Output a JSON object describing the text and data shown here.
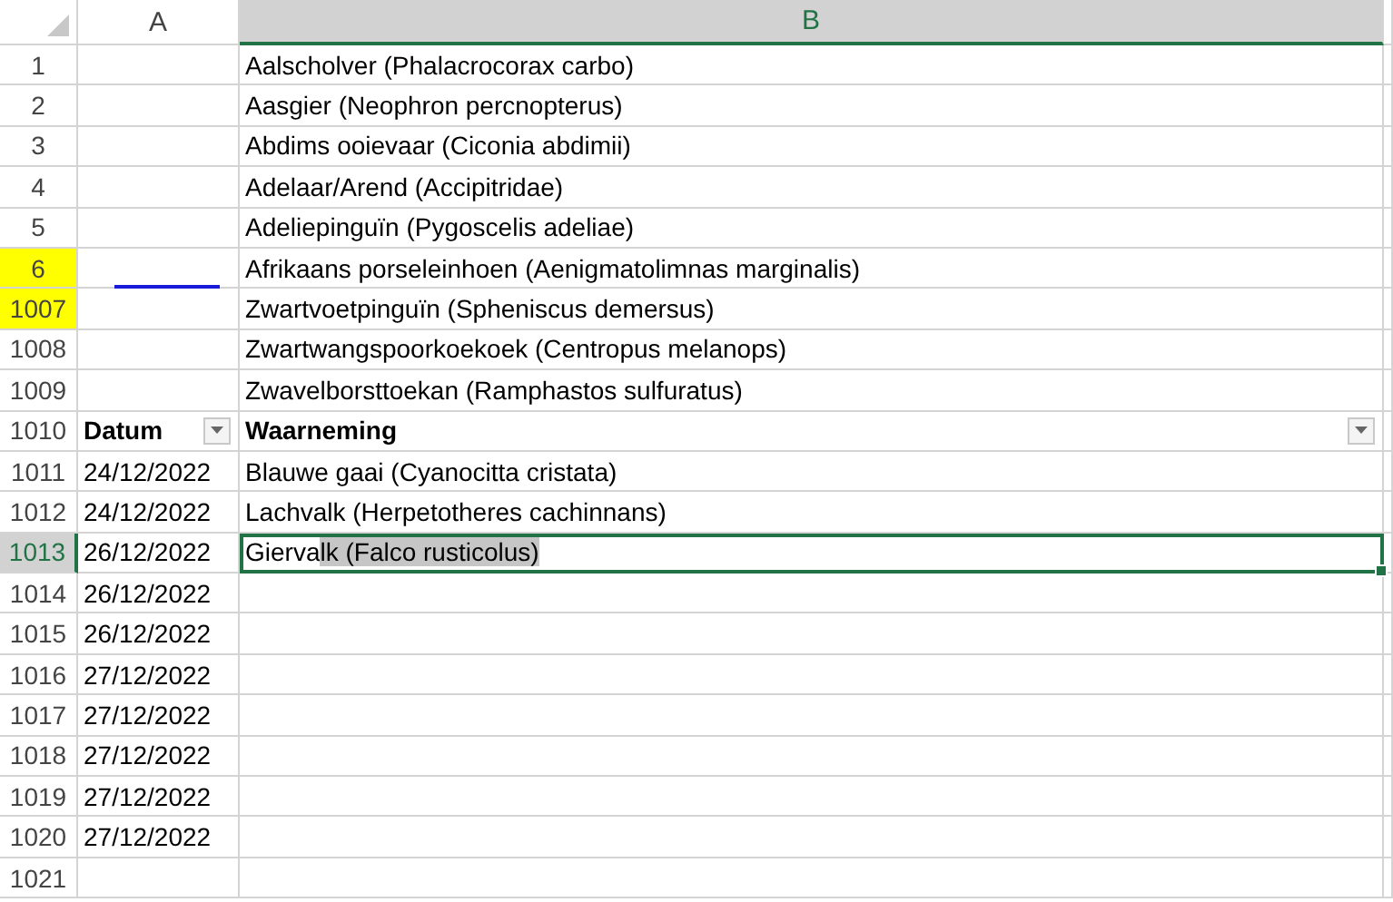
{
  "columns": [
    {
      "label": "A",
      "selected": false
    },
    {
      "label": "B",
      "selected": true
    }
  ],
  "rows": [
    {
      "number": "1",
      "b": "Aalscholver (Phalacrocorax carbo)",
      "highlighted": false,
      "selected": false,
      "underlined": false
    },
    {
      "number": "2",
      "b": "Aasgier (Neophron percnopterus)",
      "highlighted": false,
      "selected": false,
      "underlined": false
    },
    {
      "number": "3",
      "b": "Abdims ooievaar (Ciconia abdimii)",
      "highlighted": false,
      "selected": false,
      "underlined": false
    },
    {
      "number": "4",
      "b": "Adelaar/Arend (Accipitridae)",
      "highlighted": false,
      "selected": false,
      "underlined": false
    },
    {
      "number": "5",
      "b": "Adeliepinguïn (Pygoscelis adeliae)",
      "highlighted": false,
      "selected": false,
      "underlined": false
    },
    {
      "number": "6",
      "b": "Afrikaans porseleinhoen (Aenigmatolimnas marginalis)",
      "highlighted": true,
      "selected": false,
      "underlined": true
    },
    {
      "number": "1007",
      "b": "Zwartvoetpinguïn (Spheniscus demersus)",
      "highlighted": true,
      "selected": false,
      "underlined": false
    },
    {
      "number": "1008",
      "b": "Zwartwangspoorkoekoek (Centropus melanops)",
      "highlighted": false,
      "selected": false,
      "underlined": false
    },
    {
      "number": "1009",
      "b": "Zwavelborsttoekan (Ramphastos sulfuratus)",
      "highlighted": false,
      "selected": false,
      "underlined": false
    },
    {
      "number": "1010",
      "kind": "header",
      "a": "Datum",
      "b": "Waarneming",
      "highlighted": false,
      "selected": false,
      "underlined": false
    },
    {
      "number": "1011",
      "a": "24/12/2022",
      "b": "Blauwe gaai (Cyanocitta cristata)",
      "highlighted": false,
      "selected": false,
      "underlined": false
    },
    {
      "number": "1012",
      "a": "24/12/2022",
      "b": "Lachvalk (Herpetotheres cachinnans)",
      "highlighted": false,
      "selected": false,
      "underlined": false
    },
    {
      "number": "1013",
      "a": "26/12/2022",
      "b": "Gierva",
      "b_highlighted": "lk (Falco rusticolus)",
      "highlighted": false,
      "selected": true,
      "underlined": false
    },
    {
      "number": "1014",
      "a": "26/12/2022",
      "highlighted": false,
      "selected": false,
      "underlined": false
    },
    {
      "number": "1015",
      "a": "26/12/2022",
      "highlighted": false,
      "selected": false,
      "underlined": false
    },
    {
      "number": "1016",
      "a": "27/12/2022",
      "highlighted": false,
      "selected": false,
      "underlined": false
    },
    {
      "number": "1017",
      "a": "27/12/2022",
      "highlighted": false,
      "selected": false,
      "underlined": false
    },
    {
      "number": "1018",
      "a": "27/12/2022",
      "highlighted": false,
      "selected": false,
      "underlined": false
    },
    {
      "number": "1019",
      "a": "27/12/2022",
      "highlighted": false,
      "selected": false,
      "underlined": false
    },
    {
      "number": "1020",
      "a": "27/12/2022",
      "highlighted": false,
      "selected": false,
      "underlined": false
    },
    {
      "number": "1021",
      "highlighted": false,
      "selected": false,
      "underlined": false
    }
  ]
}
